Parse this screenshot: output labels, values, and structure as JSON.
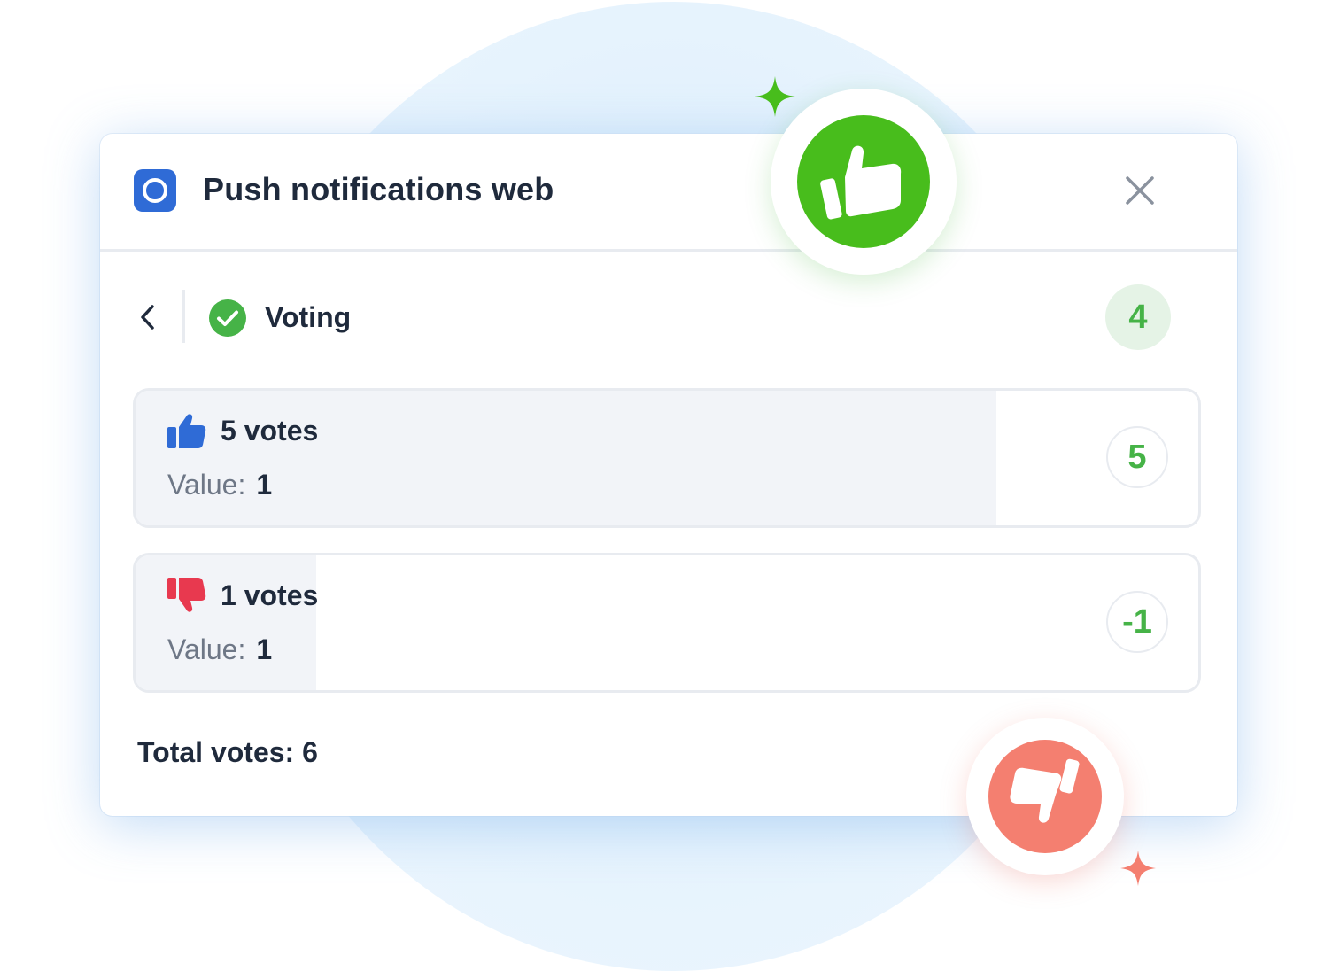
{
  "colors": {
    "accent_green": "#46b347",
    "like_green": "#48bd1c",
    "dislike_red": "#f47f70",
    "brand_blue": "#2f6bd6",
    "thumb_blue": "#2f6bd6",
    "thumb_red": "#e8394f"
  },
  "header": {
    "app_icon": "app-logo-icon",
    "title": "Push notifications web",
    "close_icon": "close-icon"
  },
  "voting": {
    "back_icon": "chevron-left-icon",
    "status_icon": "check-circle-icon",
    "title": "Voting",
    "score": "4",
    "options": [
      {
        "icon": "thumbs-up-icon",
        "votes_label": "5 votes",
        "value_label": "Value:",
        "value": "1",
        "score": "5",
        "share": 0.81
      },
      {
        "icon": "thumbs-down-icon",
        "votes_label": "1 votes",
        "value_label": "Value:",
        "value": "1",
        "score": "-1",
        "share": 0.17
      }
    ],
    "total_votes": "Total votes: 6"
  },
  "decor": {
    "like_badge_icon": "thumbs-up-icon",
    "dislike_badge_icon": "thumbs-down-icon",
    "sparkle_icon": "sparkle-icon"
  }
}
